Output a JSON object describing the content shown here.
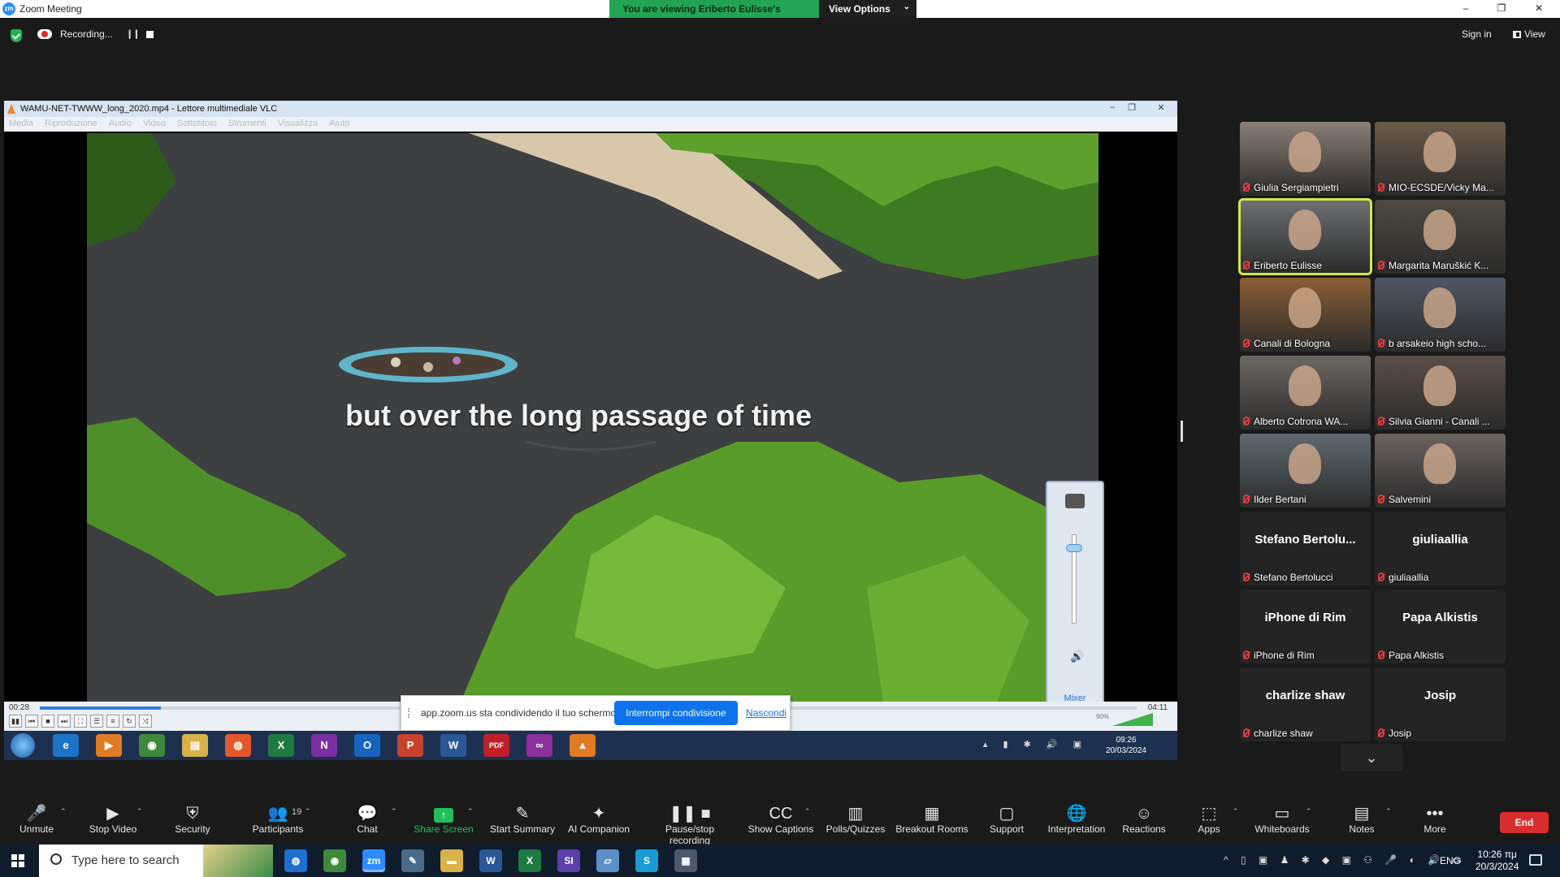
{
  "window": {
    "app_logo": "zm",
    "title": "Zoom Meeting",
    "controls": [
      "–",
      "❐",
      "✕"
    ]
  },
  "view_banner": {
    "text": "You are viewing Eriberto Eulisse's screen",
    "view_options": "View Options"
  },
  "recording": {
    "label": "Recording...",
    "pause_icon": "❙❙"
  },
  "top_right": {
    "sign_in": "Sign in",
    "view": "View"
  },
  "vlc": {
    "title": "WAMU-NET-TWWW_long_2020.mp4 - Lettore multimediale VLC",
    "menu": [
      "Media",
      "Riproduzione",
      "Audio",
      "Video",
      "Sottotitolo",
      "Strumenti",
      "Visualizza",
      "Aiuto"
    ],
    "subtitle": "but over the long passage of time",
    "elapsed": "00:28",
    "total": "04:11",
    "progress": 0.11,
    "volume_percent": "90%",
    "mixer_label": "Mixer",
    "buttons": [
      "▮▮",
      "⏮",
      "■",
      "⏭",
      "⛶",
      "☰",
      "≡",
      "↻",
      "⤨"
    ]
  },
  "share_bar": {
    "message": "app.zoom.us sta condividendo il tuo schermo.",
    "stop_button": "Interrompi condivisione",
    "hide_link": "Nascondi"
  },
  "remote_taskbar": {
    "apps": [
      "e",
      "▶",
      "◉",
      "▤",
      "◍",
      "X",
      "N",
      "O",
      "P",
      "W",
      "PDF",
      "∞",
      "▲"
    ],
    "time": "09:26",
    "date": "20/03/2024",
    "tray": "▴ ▮ ✱ 🔊 ▣"
  },
  "gallery": {
    "tiles": [
      {
        "name": "Giulia Sergiampietri",
        "color": "#8a7f76"
      },
      {
        "name": "MIO-ECSDE/Vicky Ma...",
        "color": "#6b5a4a"
      },
      {
        "name": "Eriberto Eulisse",
        "color": "#6e7073",
        "speaking": true
      },
      {
        "name": "Margarita Maruškić K...",
        "color": "#4d4a42"
      },
      {
        "name": "Canali di Bologna",
        "color": "#8a5e34"
      },
      {
        "name": "b arsakeio high scho...",
        "color": "#4e5865"
      },
      {
        "name": "Alberto Cotrona WA...",
        "color": "#6c6864"
      },
      {
        "name": "Silvia Gianni - Canali ...",
        "color": "#5a4e48"
      },
      {
        "name": "Ilder Bertani",
        "color": "#5f6a70"
      },
      {
        "name": "Salvemini",
        "color": "#6a6460"
      },
      {
        "name": "Stefano Bertolucci",
        "display": "Stefano  Bertolu...",
        "novideo": true
      },
      {
        "name": "giuliaallia",
        "display": "giuliaallia",
        "novideo": true
      },
      {
        "name": "iPhone di Rim",
        "display": "iPhone di Rim",
        "novideo": true
      },
      {
        "name": "Papa Alkistis",
        "display": "Papa Alkistis",
        "novideo": true
      },
      {
        "name": "charlize shaw",
        "display": "charlize shaw",
        "novideo": true
      },
      {
        "name": "Josip",
        "display": "Josip",
        "novideo": true
      }
    ],
    "scroll_down": "⌄"
  },
  "toolbar": {
    "items": [
      {
        "label": "Unmute",
        "icon": "🎤",
        "caret": true
      },
      {
        "label": "Stop Video",
        "icon": "▶",
        "caret": true
      },
      {
        "label": "Security",
        "icon": "⛨"
      },
      {
        "label": "Participants",
        "icon": "👥",
        "caret": true,
        "count": "19"
      },
      {
        "label": "Chat",
        "icon": "💬",
        "caret": true
      },
      {
        "label": "Share Screen",
        "icon": "↑",
        "caret": true,
        "green": true
      },
      {
        "label": "Start Summary",
        "icon": "✎"
      },
      {
        "label": "AI Companion",
        "icon": "✦"
      },
      {
        "label": "Pause/stop recording",
        "icon": "❚❚ ■"
      },
      {
        "label": "Show Captions",
        "icon": "CC",
        "caret": true
      },
      {
        "label": "Polls/Quizzes",
        "icon": "▥"
      },
      {
        "label": "Breakout Rooms",
        "icon": "▦"
      },
      {
        "label": "Support",
        "icon": "▢"
      },
      {
        "label": "Interpretation",
        "icon": "🌐"
      },
      {
        "label": "Reactions",
        "icon": "☺"
      },
      {
        "label": "Apps",
        "icon": "⬚",
        "caret": true
      },
      {
        "label": "Whiteboards",
        "icon": "▭",
        "caret": true
      },
      {
        "label": "Notes",
        "icon": "▤",
        "caret": true
      },
      {
        "label": "More",
        "icon": "•••"
      }
    ],
    "end": "End"
  },
  "windows_taskbar": {
    "search_placeholder": "Type here to search",
    "apps": [
      "◍",
      "◉",
      "zm",
      "✎",
      "▬",
      "W",
      "X",
      "SI",
      "▱",
      "S",
      "▦"
    ],
    "tray": "^ ▯ ▣ ♟ ✱ ◆ ▣ ⚇ 🎤 ◐ 🔊 ▭",
    "lang": "ENG",
    "time": "10:26 πμ",
    "date": "20/3/2024"
  }
}
